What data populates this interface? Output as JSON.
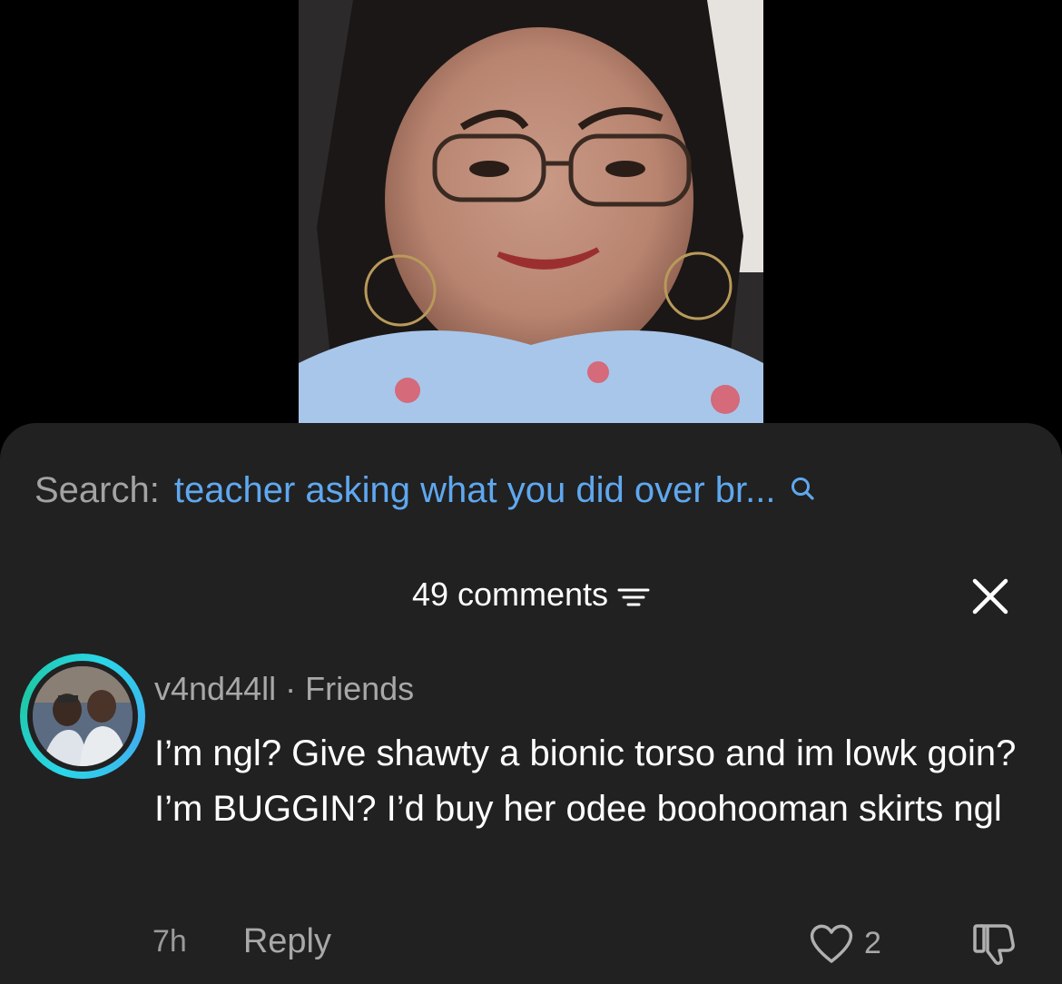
{
  "search": {
    "label": "Search:",
    "query": "teacher asking what you did over br...",
    "icon": "search-icon"
  },
  "comments": {
    "count_label": "49 comments",
    "sort_icon": "sort-lines-icon",
    "close_icon": "close-icon"
  },
  "comment": {
    "username": "v4nd44ll",
    "separator": "·",
    "relation": "Friends",
    "text": "I’m ngl? Give shawty a bionic torso and im lowk goin? I’m BUGGIN? I’d buy her odee boohooman skirts ngl",
    "time": "7h",
    "reply_label": "Reply",
    "like_count": "2"
  },
  "colors": {
    "background": "#000000",
    "sheet": "#212121",
    "search_query": "#5fa8f0",
    "avatar_ring": "#2bd6e8"
  }
}
